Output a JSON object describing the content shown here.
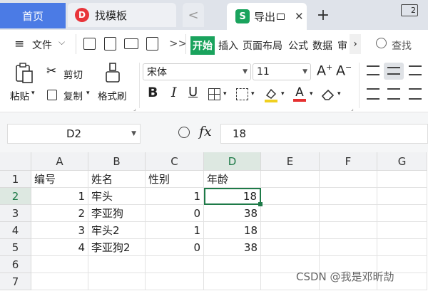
{
  "tabs": {
    "home": "首页",
    "template": "找模板",
    "doc": "导出",
    "template_icon_char": "D",
    "doc_icon_char": "S",
    "new_tab": "+",
    "nav_back": "<",
    "window_badge": "2"
  },
  "ribbon_tabs": {
    "menu": "≡",
    "file": "文件",
    "start": "开始",
    "insert": "插入",
    "page_layout": "页面布局",
    "formula": "公式",
    "data": "数据",
    "review": "审",
    "more": ">>",
    "find": "查找"
  },
  "ribbon": {
    "paste": "粘贴",
    "cut": "剪切",
    "copy": "复制",
    "format_painter": "格式刷",
    "font_name": "宋体",
    "font_size": "11",
    "bold": "B",
    "italic": "I",
    "underline": "U",
    "font_color_glyph": "A"
  },
  "formula_bar": {
    "cell_ref": "D2",
    "fx": "fx",
    "value": "18"
  },
  "sheet": {
    "columns": [
      "A",
      "B",
      "C",
      "D",
      "E",
      "F",
      "G"
    ],
    "rows": [
      "1",
      "2",
      "3",
      "4",
      "5",
      "6",
      "7"
    ],
    "headers": [
      "编号",
      "姓名",
      "性别",
      "年龄"
    ],
    "data": [
      [
        "1",
        "牢头",
        "1",
        "18"
      ],
      [
        "2",
        "李亚狗",
        "0",
        "38"
      ],
      [
        "3",
        "牢头2",
        "1",
        "18"
      ],
      [
        "4",
        "李亚狗2",
        "0",
        "38"
      ]
    ],
    "selected_cell": "D2"
  },
  "watermark": "CSDN @我是邓昕劼",
  "colors": {
    "accent_blue": "#4b7be5",
    "start_green": "#1aa35d",
    "selection_green": "#1e7a48"
  }
}
